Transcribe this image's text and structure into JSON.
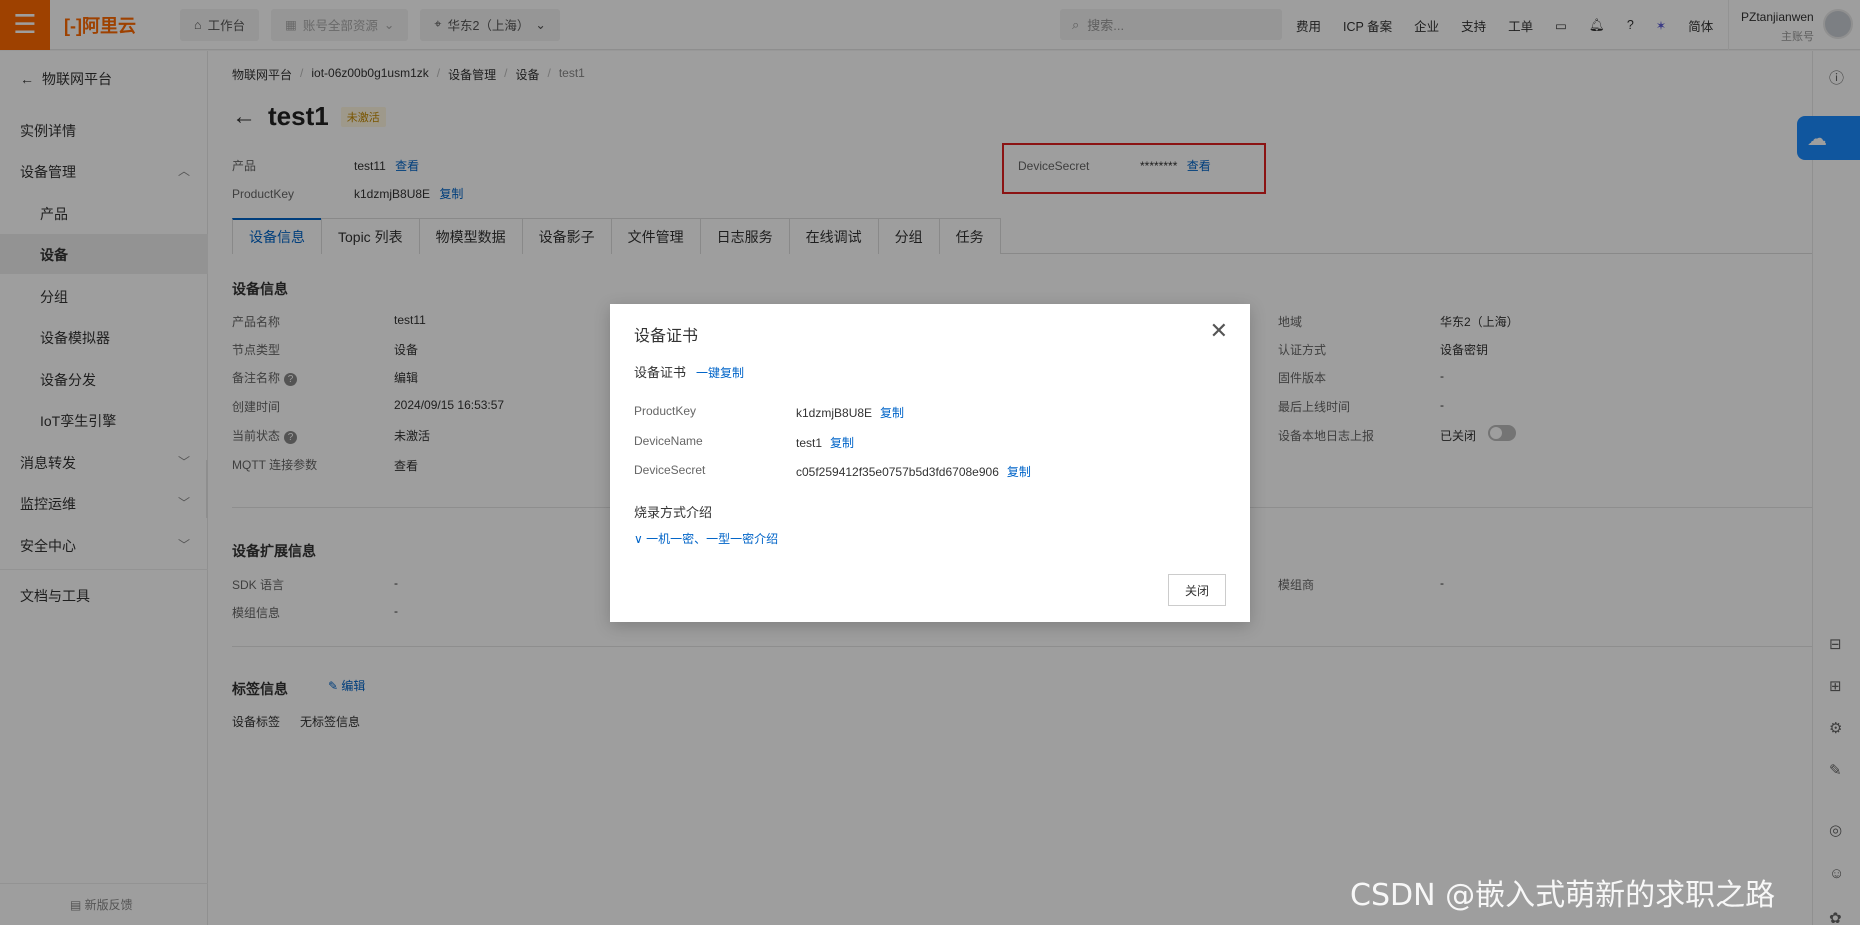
{
  "topbar": {
    "menu_icon": "menu-icon",
    "logo": "[-]阿里云",
    "workbench": "工作台",
    "account_resources": "账号全部资源",
    "region": "华东2（上海）",
    "search_placeholder": "搜索...",
    "links": [
      "费用",
      "ICP 备案",
      "企业",
      "支持",
      "工单"
    ],
    "lang": "简体",
    "user_name": "PZtanjianwen",
    "user_role": "主账号"
  },
  "sidebar": {
    "back_label": "物联网平台",
    "items": [
      "实例详情",
      "设备管理",
      "产品",
      "设备",
      "分组",
      "设备模拟器",
      "设备分发",
      "IoT孪生引擎",
      "消息转发",
      "监控运维",
      "安全中心",
      "文档与工具"
    ],
    "feedback": "新版反馈"
  },
  "breadcrumb": [
    "物联网平台",
    "iot-06z00b0g1usm1zk",
    "设备管理",
    "设备",
    "test1"
  ],
  "page": {
    "title": "test1",
    "status_badge": "未激活",
    "product_label": "产品",
    "product_value": "test11",
    "view": "查看",
    "productkey_label": "ProductKey",
    "productkey_value": "k1dzmjB8U8E",
    "copy": "复制",
    "devicesecret_label": "DeviceSecret",
    "devicesecret_value": "********"
  },
  "tabs": [
    "设备信息",
    "Topic 列表",
    "物模型数据",
    "设备影子",
    "文件管理",
    "日志服务",
    "在线调试",
    "分组",
    "任务"
  ],
  "device_info": {
    "title": "设备信息",
    "left_fields": [
      {
        "k": "产品名称",
        "v": "test11"
      },
      {
        "k": "节点类型",
        "v": "设备"
      },
      {
        "k": "备注名称",
        "v": "编辑"
      },
      {
        "k": "创建时间",
        "v": "2024/09/15 16:53:57"
      },
      {
        "k": "当前状态",
        "v": "未激活"
      },
      {
        "k": "MQTT 连接参数",
        "v": "查看"
      }
    ],
    "right_fields": [
      {
        "k": "地域",
        "v": "华东2（上海）"
      },
      {
        "k": "认证方式",
        "v": "设备密钥"
      },
      {
        "k": "固件版本",
        "v": "-"
      },
      {
        "k": "最后上线时间",
        "v": "-"
      },
      {
        "k": "设备本地日志上报",
        "v": "已关闭"
      }
    ]
  },
  "ext_info": {
    "title": "设备扩展信息",
    "fields": [
      {
        "k": "SDK 语言",
        "v": "-"
      },
      {
        "k": "模组信息",
        "v": "-"
      }
    ],
    "right_k": "模组商",
    "right_v": "-"
  },
  "tags": {
    "title": "标签信息",
    "edit": "编辑",
    "k": "设备标签",
    "v": "无标签信息"
  },
  "modal": {
    "title": "设备证书",
    "sub_title": "设备证书",
    "copy_all": "一键复制",
    "rows": [
      {
        "k": "ProductKey",
        "v": "k1dzmjB8U8E",
        "copy": "复制"
      },
      {
        "k": "DeviceName",
        "v": "test1",
        "copy": "复制"
      },
      {
        "k": "DeviceSecret",
        "v": "c05f259412f35e0757b5d3fd6708e906",
        "copy": "复制"
      }
    ],
    "burn_title": "烧录方式介绍",
    "burn_link": "一机一密、一型一密介绍",
    "close_button": "关闭"
  },
  "watermark": "CSDN @嵌入式萌新的求职之路",
  "colors": {
    "brand": "#ff6a00",
    "link": "#0064c8",
    "highlight_box": "#e02020"
  }
}
